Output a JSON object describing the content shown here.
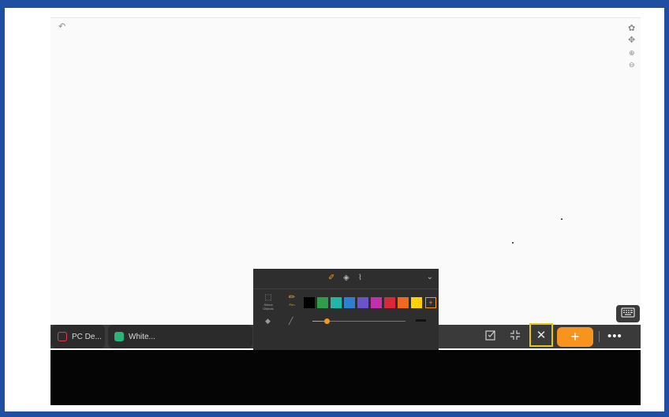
{
  "canvas_tools": {
    "undo_icon": "undo-icon",
    "settings_icon": "gear-icon",
    "move_icon": "move-icon",
    "zoom_in_icon": "zoom-in-icon",
    "zoom_out_icon": "zoom-out-icon"
  },
  "pen_panel": {
    "header_icons": [
      "pen-tools-icon",
      "eraser-icon",
      "attachment-icon"
    ],
    "tools": [
      {
        "label": "Select Objects",
        "icon": "select-icon"
      },
      {
        "label": "Pen",
        "icon": "pen-icon",
        "active": true
      }
    ],
    "colors": [
      "#000000",
      "#2e9e4a",
      "#23b5a7",
      "#2f7fd1",
      "#6b54c9",
      "#c231a8",
      "#d8283a",
      "#f06a1c",
      "#ffd200"
    ],
    "selected_color": "#ffd200",
    "stroke_width": 0.15
  },
  "taskbar": {
    "tasks": [
      {
        "label": "PC De...",
        "color": "#e8384f"
      },
      {
        "label": "White...",
        "color": "#2bb37a"
      }
    ],
    "pin_icon": "pin-icon",
    "actions": [
      {
        "icon": "checkbox-edit-icon"
      },
      {
        "icon": "minimize-icon"
      },
      {
        "icon": "close-icon"
      }
    ],
    "add_label": "+",
    "more_label": "•••"
  },
  "keyboard_icon": "keyboard-icon",
  "colors": {
    "accent": "#f7941d",
    "highlight": "#e6c418",
    "desktop": "#1f4ea3"
  }
}
